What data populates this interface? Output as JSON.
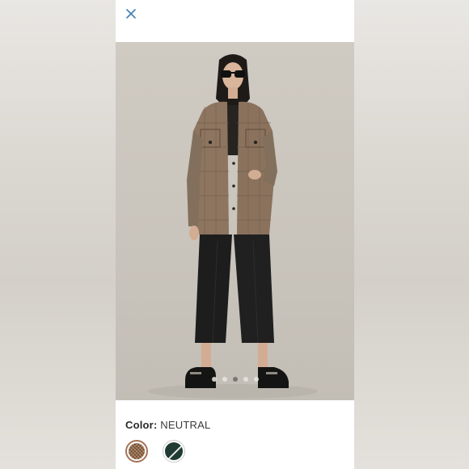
{
  "colors": {
    "panel_bg": "#ffffff",
    "close_icon": "#3f7fb0",
    "selected_swatch_border": "#a47458"
  },
  "header": {
    "close_icon": "close-icon"
  },
  "gallery": {
    "image_count": 5,
    "active_index": 2
  },
  "product": {
    "color_label": "Color:",
    "color_value": "NEUTRAL",
    "swatches": [
      {
        "name": "neutral-plaid",
        "selected": true
      },
      {
        "name": "dark-green-unavailable",
        "selected": false
      }
    ]
  }
}
